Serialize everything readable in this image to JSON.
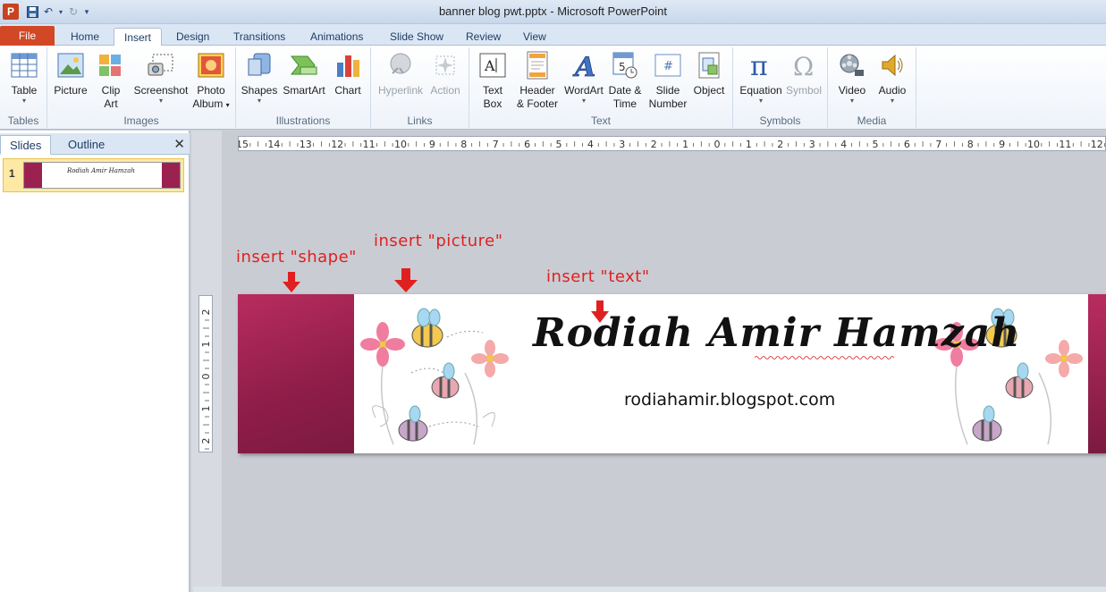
{
  "window": {
    "title": "banner blog pwt.pptx  -  Microsoft PowerPoint",
    "app_icon": "P"
  },
  "tabs": [
    {
      "label": "File"
    },
    {
      "label": "Home"
    },
    {
      "label": "Insert"
    },
    {
      "label": "Design"
    },
    {
      "label": "Transitions"
    },
    {
      "label": "Animations"
    },
    {
      "label": "Slide Show"
    },
    {
      "label": "Review"
    },
    {
      "label": "View"
    }
  ],
  "ribbon": {
    "tables": {
      "label": "Tables",
      "table": "Table"
    },
    "images": {
      "label": "Images",
      "picture": "Picture",
      "clipart_1": "Clip",
      "clipart_2": "Art",
      "screenshot": "Screenshot",
      "photoalbum_1": "Photo",
      "photoalbum_2": "Album"
    },
    "illustrations": {
      "label": "Illustrations",
      "shapes": "Shapes",
      "smartart": "SmartArt",
      "chart": "Chart"
    },
    "links": {
      "label": "Links",
      "hyperlink": "Hyperlink",
      "action": "Action"
    },
    "text": {
      "label": "Text",
      "textbox_1": "Text",
      "textbox_2": "Box",
      "header_1": "Header",
      "header_2": "& Footer",
      "wordart": "WordArt",
      "datetime_1": "Date &",
      "datetime_2": "Time",
      "slidenum_1": "Slide",
      "slidenum_2": "Number",
      "object": "Object"
    },
    "symbols": {
      "label": "Symbols",
      "equation": "Equation",
      "symbol": "Symbol"
    },
    "media": {
      "label": "Media",
      "video": "Video",
      "audio": "Audio"
    }
  },
  "leftpane": {
    "tab_slides": "Slides",
    "tab_outline": "Outline",
    "close": "✕",
    "slide_number": "1"
  },
  "ruler": {
    "h_labels": [
      "15",
      "14",
      "13",
      "12",
      "11",
      "10",
      "9",
      "8",
      "7",
      "6",
      "5",
      "4",
      "3",
      "2",
      "1",
      "0",
      "1",
      "2",
      "3",
      "4",
      "5",
      "6",
      "7",
      "8",
      "9",
      "10",
      "11",
      "12"
    ],
    "v_labels": [
      "2",
      "1",
      "0",
      "1",
      "2"
    ]
  },
  "slide": {
    "title": "Rodiah Amir Hamzah",
    "url": "rodiahamir.blogspot.com"
  },
  "annotations": {
    "shape": "insert \"shape\"",
    "picture": "insert \"picture\"",
    "text": "insert \"text\""
  },
  "colors": {
    "accent": "#d24726",
    "banner": "#9b2250",
    "annotation": "#e02020"
  }
}
